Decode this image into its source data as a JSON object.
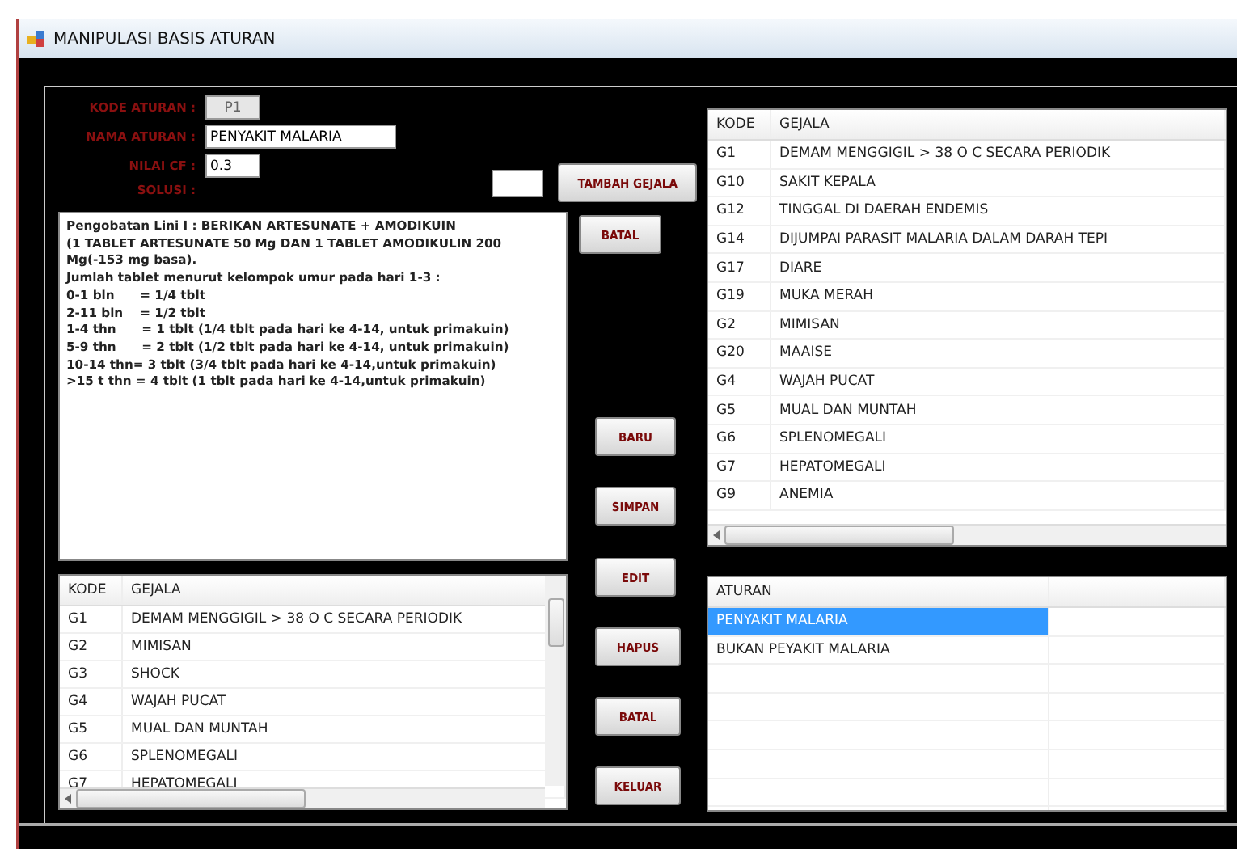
{
  "window": {
    "title": "MANIPULASI BASIS ATURAN"
  },
  "form": {
    "fields": [
      {
        "label": "KODE ATURAN :",
        "value": "P1",
        "disabled": true
      },
      {
        "label": "NAMA ATURAN :",
        "value": "PENYAKIT MALARIA",
        "disabled": false
      },
      {
        "label": "NILAI CF :",
        "value": "0.3",
        "disabled": false
      }
    ],
    "solution_label": "SOLUSI :",
    "add_button": "TAMBAH GEJALA"
  },
  "solution_text": [
    "Pengobatan Lini I : BERIKAN ARTESUNATE + AMODIKUIN",
    "(1 TABLET ARTESUNATE 50 Mg DAN 1 TABLET AMODIKULIN 200 Mg(-153 mg basa).",
    "Jumlah tablet menurut kelompok umur pada hari 1-3 :",
    "0-1 bln      = 1/4 tblt",
    "2-11 bln    = 1/2 tblt",
    "1-4 thn      = 1 tblt (1/4 tblt pada hari ke 4-14, untuk primakuin)",
    "5-9 thn      = 2 tblt (1/2 tblt pada hari ke 4-14, untuk primakuin)",
    "10-14 thn= 3 tblt (3/4 tblt pada hari ke 4-14,untuk primakuin)",
    ">15 t thn = 4 tblt (1 tblt pada hari ke 4-14,untuk primakuin)"
  ],
  "cancel_button": "BATAL",
  "action_buttons": [
    "BARU",
    "SIMPAN",
    "EDIT",
    "HAPUS",
    "BATAL",
    "KELUAR"
  ],
  "symptom_list": {
    "columns": [
      "KODE",
      "GEJALA"
    ],
    "rows": [
      [
        "G1",
        "DEMAM MENGGIGIL > 38 O C SECARA PERIODIK"
      ],
      [
        "G2",
        "MIMISAN"
      ],
      [
        "G3",
        "SHOCK"
      ],
      [
        "G4",
        "WAJAH PUCAT"
      ],
      [
        "G5",
        "MUAL DAN MUNTAH"
      ],
      [
        "G6",
        "SPLENOMEGALI"
      ],
      [
        "G7",
        "HEPATOMEGALI"
      ]
    ]
  },
  "rule_symptoms": {
    "columns": [
      "KODE",
      "GEJALA"
    ],
    "rows": [
      [
        "G1",
        "DEMAM MENGGIGIL > 38 O C SECARA PERIODIK"
      ],
      [
        "G10",
        "SAKIT KEPALA"
      ],
      [
        "G12",
        "TINGGAL DI DAERAH ENDEMIS"
      ],
      [
        "G14",
        "DIJUMPAI PARASIT MALARIA DALAM DARAH TEPI"
      ],
      [
        "G17",
        "DIARE"
      ],
      [
        "G19",
        "MUKA MERAH"
      ],
      [
        "G2",
        "MIMISAN"
      ],
      [
        "G20",
        "MAAISE"
      ],
      [
        "G4",
        "WAJAH PUCAT"
      ],
      [
        "G5",
        "MUAL DAN MUNTAH"
      ],
      [
        "G6",
        "SPLENOMEGALI"
      ],
      [
        "G7",
        "HEPATOMEGALI"
      ],
      [
        "G9",
        "ANEMIA"
      ]
    ]
  },
  "rules": {
    "column": "ATURAN",
    "rows": [
      {
        "label": "PENYAKIT MALARIA",
        "selected": true
      },
      {
        "label": "BUKAN PEYAKIT MALARIA",
        "selected": false
      }
    ]
  }
}
